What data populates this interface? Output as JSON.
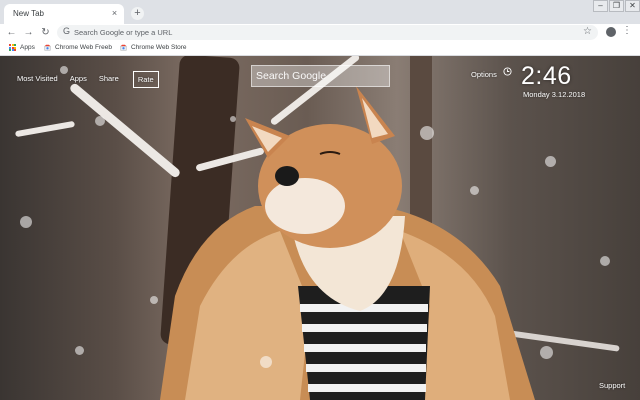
{
  "browser": {
    "tab_title": "New Tab",
    "tab_close": "×",
    "new_tab": "+",
    "window_controls": [
      "–",
      "❐",
      "✕"
    ],
    "nav": {
      "back": "←",
      "forward": "→",
      "reload": "↻"
    },
    "omnibox_placeholder": "Search Google or type a URL",
    "bookmarks": [
      {
        "label": "Apps",
        "icon": "apps-grid-icon"
      },
      {
        "label": "Chrome Web Freeb",
        "icon": "webstore-icon"
      },
      {
        "label": "Chrome Web Store",
        "icon": "webstore-icon"
      }
    ]
  },
  "newtab": {
    "nav_links": [
      "Most Visited",
      "Apps",
      "Share",
      "Rate"
    ],
    "search_placeholder": "Search Google",
    "options_label": "Options",
    "time": "2:46",
    "date": "Monday  3.12.2018",
    "support_label": "Support"
  },
  "colors": {
    "accent_text": "#ffffff",
    "chrome_bg": "#dee1e6"
  }
}
